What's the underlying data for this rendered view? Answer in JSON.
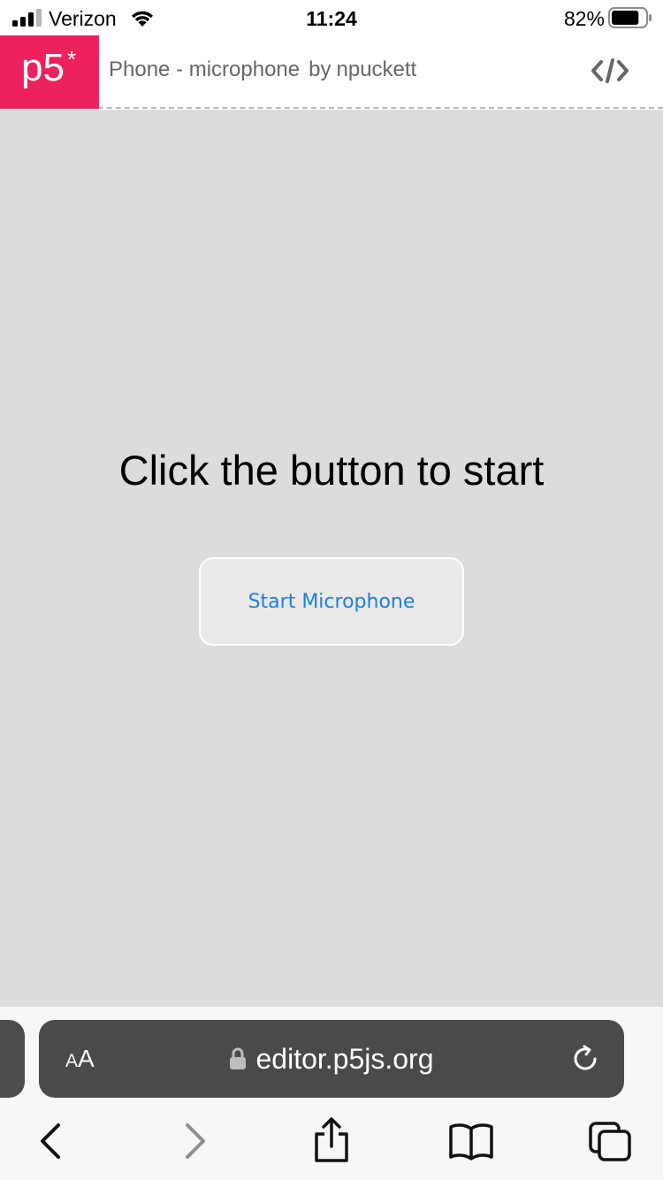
{
  "status_bar": {
    "carrier": "Verizon",
    "time": "11:24",
    "battery_percent": "82%",
    "battery_level": 0.82,
    "icons": [
      "signal-bars-icon",
      "wifi-icon",
      "battery-icon"
    ]
  },
  "header": {
    "logo_text": "p5",
    "logo_star": "*",
    "sketch_name": "Phone - microphone",
    "by_label": "by",
    "author": "npuckett",
    "code_toggle_icon": "code-brackets-icon",
    "brand_color": "#ed225d"
  },
  "canvas": {
    "background_color": "#dcdcdc",
    "prompt": "Click the button to start",
    "start_button_label": "Start Microphone",
    "button_text_color": "#1a7fe0"
  },
  "browser": {
    "text_size_label_small": "A",
    "text_size_label_large": "A",
    "url": "editor.p5js.org",
    "icons": [
      "lock-icon",
      "reload-icon",
      "back-icon",
      "forward-icon",
      "share-icon",
      "bookmarks-icon",
      "tabs-icon"
    ]
  }
}
